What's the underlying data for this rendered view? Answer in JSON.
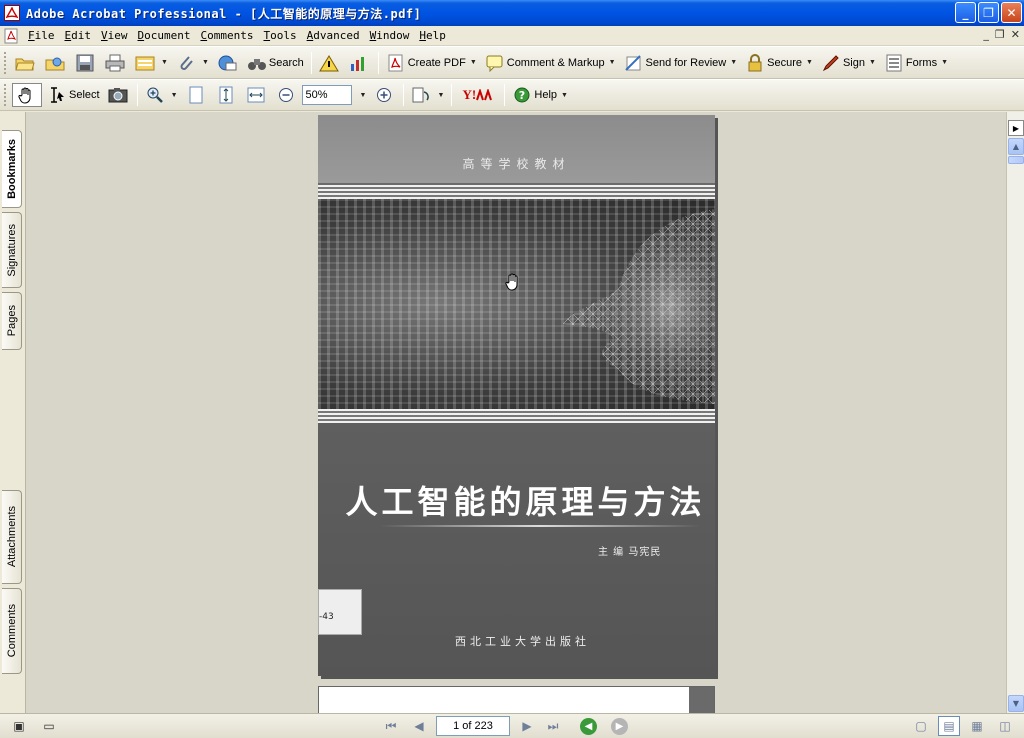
{
  "window": {
    "title": "Adobe Acrobat Professional - [人工智能的原理与方法.pdf]",
    "controls": {
      "minimize": "_",
      "restore": "❐",
      "close": "✕"
    }
  },
  "menubar": {
    "items": [
      "File",
      "Edit",
      "View",
      "Document",
      "Comments",
      "Tools",
      "Advanced",
      "Window",
      "Help"
    ],
    "mdi": {
      "minimize": "_",
      "restore": "❐",
      "close": "✕"
    }
  },
  "toolbar1": {
    "search": "Search",
    "create_pdf": "Create PDF",
    "comment_markup": "Comment & Markup",
    "send_review": "Send for Review",
    "secure": "Secure",
    "sign": "Sign",
    "forms": "Forms"
  },
  "toolbar2": {
    "select": "Select",
    "zoom_value": "50%",
    "help": "Help",
    "yahoo": "Y!"
  },
  "nav_tabs": [
    "Bookmarks",
    "Signatures",
    "Pages",
    "Attachments",
    "Comments"
  ],
  "document": {
    "series": "高等学校教材",
    "title": "人工智能的原理与方法",
    "editor": "主  编  马宪民",
    "sticker": "-43",
    "publisher": "西北工业大学出版社"
  },
  "statusbar": {
    "page_display": "1 of 223"
  },
  "colors": {
    "titlebar": "#0054e3",
    "chrome": "#ece9d8",
    "doc_bg": "#d8d6c8"
  }
}
